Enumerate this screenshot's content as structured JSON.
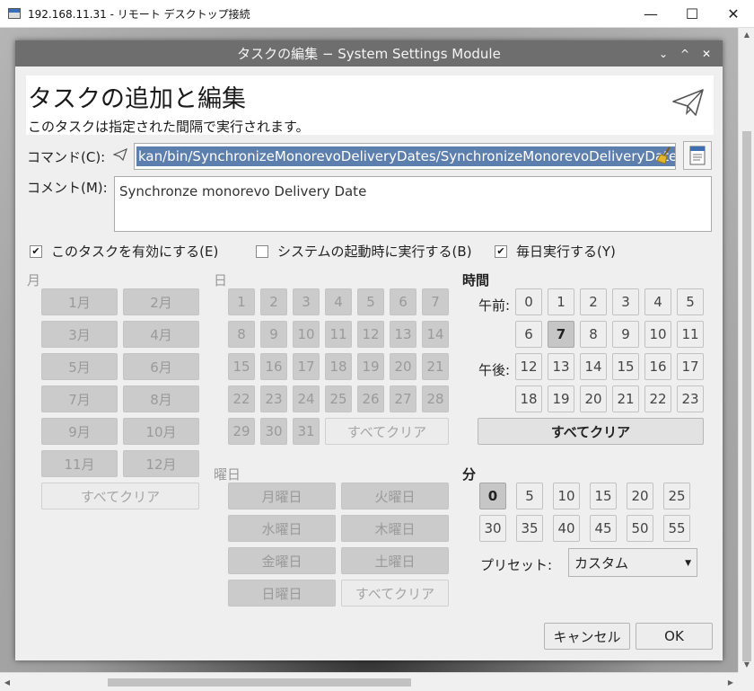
{
  "rdp": {
    "title": "192.168.11.31 - リモート デスクトップ接続",
    "controls": [
      "—",
      "☐",
      "✕"
    ]
  },
  "dialog": {
    "title": "タスクの編集 − System Settings Module",
    "controls": [
      "⌄",
      "^",
      "✕"
    ]
  },
  "header": {
    "title": "タスクの追加と編集",
    "subtitle": "このタスクは指定された間隔で実行されます。",
    "icon": "send-icon"
  },
  "command": {
    "label": "コマンド(C):",
    "value": "kan/bin/SynchronizeMonorevoDeliveryDates/SynchronizeMonorevoDeliveryDates"
  },
  "comment": {
    "label": "コメント(M):",
    "value": "Synchronze monorevo Delivery Date"
  },
  "options": [
    {
      "label": "このタスクを有効にする(E)",
      "checked": true
    },
    {
      "label": "システムの起動時に実行する(B)",
      "checked": false
    },
    {
      "label": "毎日実行する(Y)",
      "checked": true
    }
  ],
  "months": {
    "label": "月",
    "items": [
      "1月",
      "2月",
      "3月",
      "4月",
      "5月",
      "6月",
      "7月",
      "8月",
      "9月",
      "10月",
      "11月",
      "12月"
    ],
    "clear": "すべてクリア"
  },
  "days": {
    "label": "日",
    "items": [
      "1",
      "2",
      "3",
      "4",
      "5",
      "6",
      "7",
      "8",
      "9",
      "10",
      "11",
      "12",
      "13",
      "14",
      "15",
      "16",
      "17",
      "18",
      "19",
      "20",
      "21",
      "22",
      "23",
      "24",
      "25",
      "26",
      "27",
      "28",
      "29",
      "30",
      "31"
    ],
    "clear": "すべてクリア"
  },
  "weekdays": {
    "label": "曜日",
    "items": [
      "月曜日",
      "火曜日",
      "水曜日",
      "木曜日",
      "金曜日",
      "土曜日",
      "日曜日"
    ],
    "clear": "すべてクリア"
  },
  "hours": {
    "label": "時間",
    "am_label": "午前:",
    "pm_label": "午後:",
    "items": [
      "0",
      "1",
      "2",
      "3",
      "4",
      "5",
      "6",
      "7",
      "8",
      "9",
      "10",
      "11",
      "12",
      "13",
      "14",
      "15",
      "16",
      "17",
      "18",
      "19",
      "20",
      "21",
      "22",
      "23"
    ],
    "selected": "7",
    "clear": "すべてクリア"
  },
  "minutes": {
    "label": "分",
    "items": [
      "0",
      "5",
      "10",
      "15",
      "20",
      "25",
      "30",
      "35",
      "40",
      "45",
      "50",
      "55"
    ],
    "selected": "0"
  },
  "preset": {
    "label": "プリセット:",
    "value": "カスタム"
  },
  "footer": {
    "cancel": "キャンセル",
    "ok": "OK"
  }
}
